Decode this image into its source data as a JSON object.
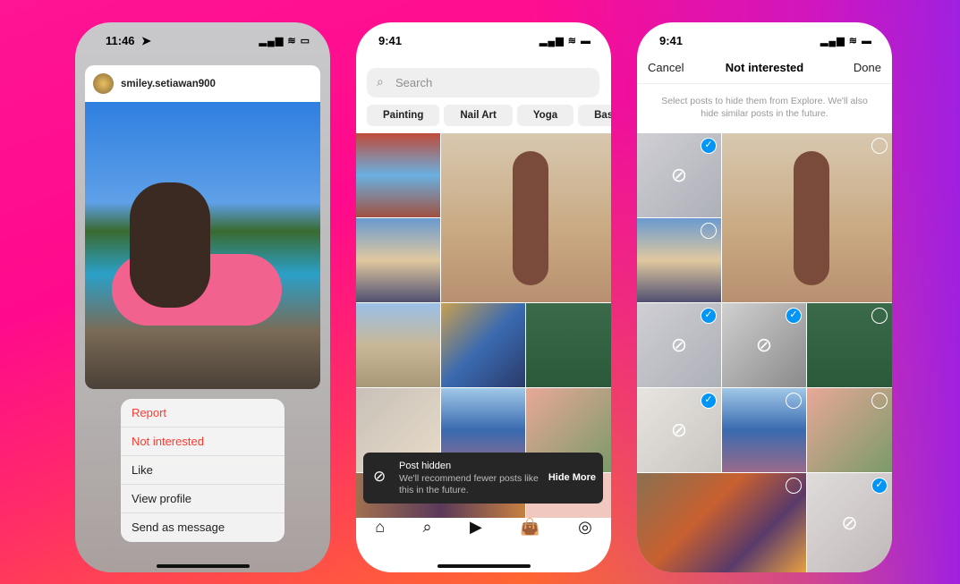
{
  "phone1": {
    "time": "11:46",
    "username": "smiley.setiawan900",
    "menu": [
      "Report",
      "Not interested",
      "Like",
      "View profile",
      "Send as message"
    ]
  },
  "phone2": {
    "time": "9:41",
    "search_placeholder": "Search",
    "chips": [
      "Painting",
      "Nail Art",
      "Yoga",
      "Base"
    ],
    "toast": {
      "title": "Post hidden",
      "body": "We'll recommend fewer posts like this in the future.",
      "action": "Hide More"
    },
    "nav": [
      "home-icon",
      "search-icon",
      "reels-icon",
      "shop-icon",
      "profile-icon"
    ]
  },
  "phone3": {
    "time": "9:41",
    "cancel": "Cancel",
    "title": "Not interested",
    "done": "Done",
    "subtitle": "Select posts to hide them from Explore. We'll also hide similar posts in the future."
  },
  "colors": {
    "accent": "#0095f6",
    "destructive": "#ff3b30"
  }
}
